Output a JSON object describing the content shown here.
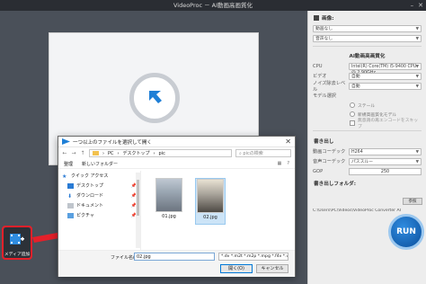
{
  "window": {
    "title": "VideoProc － AI動画高画質化"
  },
  "stage": {
    "media_button_label": "メディア追加"
  },
  "panel": {
    "video_header": "画像:",
    "video_select": "動画なし",
    "audio_select": "音声なし",
    "ai_header": "AI動画高画質化",
    "rows": [
      {
        "label": "CPU",
        "value": "Intel(R) Core(TM) i5-9400 CPU @ 2.90GHz"
      },
      {
        "label": "ビデオ",
        "value": "自動"
      },
      {
        "label": "ノイズ除去レベル",
        "value": "自動"
      }
    ],
    "model_label": "モデル選択",
    "radio_1": "ステール",
    "radio_2": "新規高画質化モデル",
    "check_1": "無意識の再エンコードをスキップ",
    "output_header": "書き出し",
    "out_rows": [
      {
        "label": "動画コーデック",
        "value": "H264"
      },
      {
        "label": "音声コーデック",
        "value": "パススルー"
      },
      {
        "label": "GOP",
        "value": "250"
      }
    ],
    "save_header": "書き出しフォルダ:",
    "browse": "参照",
    "path": "C:\\Users\\PC\\Videos\\VideoProc Converter AI",
    "run_label": "RUN"
  },
  "dialog": {
    "title": "一つ以上のファイルを選択して開く",
    "path": [
      "PC",
      "デスクトップ",
      "pic"
    ],
    "search_placeholder": "picの検索",
    "organize": "整理",
    "new_folder": "新しいフォルダー",
    "nav": [
      {
        "label": "クイック アクセス"
      },
      {
        "label": "デスクトップ"
      },
      {
        "label": "ダウンロード"
      },
      {
        "label": "ドキュメント"
      },
      {
        "label": "ピクチャ"
      }
    ],
    "files": [
      {
        "name": "01.jpg"
      },
      {
        "name": "02.jpg"
      }
    ],
    "filename_label": "ファイル名(N):",
    "filename_value": "02.jpg",
    "filetype": "*.dv *.m2t *.m2p *.mpg *.f4v *.vi",
    "open_label": "開く(O)",
    "cancel_label": "キャンセル"
  },
  "colors": {
    "accent": "#1f7fd6",
    "highlight": "#e4202a"
  }
}
